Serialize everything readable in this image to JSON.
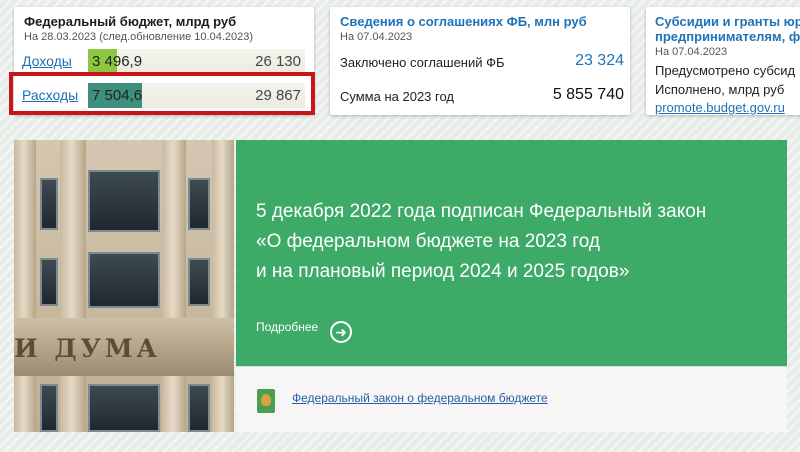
{
  "budget_card": {
    "title": "Федеральный бюджет, млрд руб",
    "date": "На 28.03.2023 (след.обновление 10.04.2023)",
    "rows": [
      {
        "label": "Доходы",
        "value": "3 496,9",
        "plan": "26 130",
        "fill_fraction": 0.134,
        "fill_color": "#8dc63f"
      },
      {
        "label": "Расходы",
        "value": "7 504,6",
        "plan": "29 867",
        "fill_fraction": 0.251,
        "fill_color": "#3f8f7e"
      }
    ]
  },
  "agreements_card": {
    "title": "Сведения о соглашениях ФБ, млн руб",
    "date": "На 07.04.2023",
    "rows": [
      {
        "label": "Заключено соглашений ФБ",
        "value": "23 324"
      },
      {
        "label": "Сумма на 2023 год",
        "value": "5 855 740"
      }
    ]
  },
  "subsidies_card": {
    "title_line1": "Субсидии и гранты юр",
    "title_line2": "предпринимателям, фи",
    "date": "На 07.04.2023",
    "line1": "Предусмотрено субсид",
    "line2": "Исполнено, млрд руб",
    "link": "promote.budget.gov.ru"
  },
  "banner": {
    "photo_text": "И ДУМА",
    "headline_line1": "5 декабря 2022 года подписан Федеральный закон",
    "headline_line2": "«О федеральном бюджете на 2023 год",
    "headline_line3": "и на плановый период 2024 и 2025 годов»",
    "more_label": "Подробнее",
    "more_icon": "arrow-right-circle-icon",
    "law_link": "Федеральный закон о федеральном бюджете",
    "law_icon": "document-emblem-icon",
    "green_color": "#3eaa68"
  }
}
